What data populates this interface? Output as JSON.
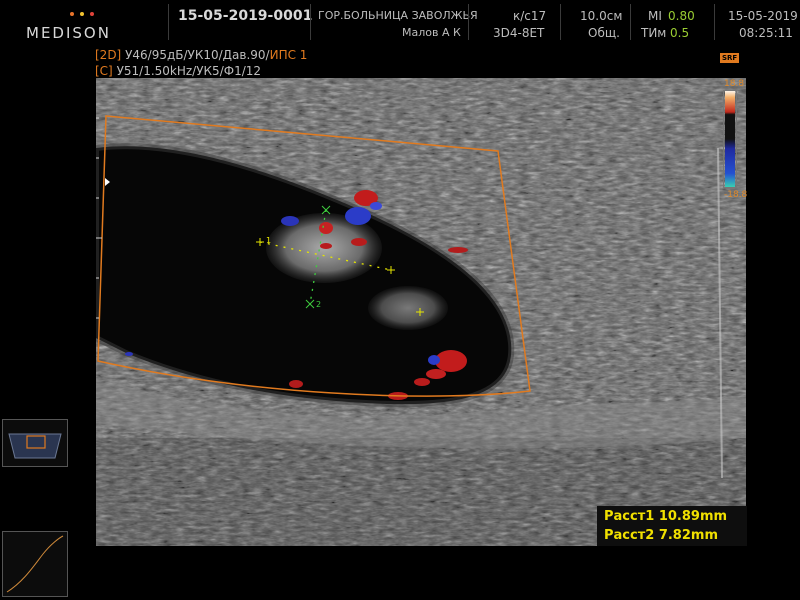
{
  "header": {
    "brand": "MEDISON",
    "brand_dot_colors": [
      "#e8732a",
      "#f2c230",
      "#e0433a"
    ],
    "patient_id": "15-05-2019-0001",
    "hospital": "ГОР.БОЛЬНИЦА ЗАВОЛЖЬЯ",
    "operator": "Малов А К",
    "frame_rate": "к/с17",
    "probe": "3D4-8ET",
    "depth": "10.0см",
    "preset": "Общ.",
    "mi_label": "MI",
    "mi_value": "0.80",
    "tim_label": "ТИм",
    "tim_value": "0.5",
    "date": "15-05-2019",
    "time": "08:25:11"
  },
  "mode_lines": {
    "line1_mode": "[2D]",
    "line1_params": " У46/95дБ/УК10/Дав.90/",
    "line1_highlight": "ИПС 1",
    "line2_mode": "[C]",
    "line2_params": " У51/1.50kHz/УК5/Ф1/12"
  },
  "color_bar": {
    "top_label": "18.8",
    "bottom_label": "-18.8",
    "badge": "SRF"
  },
  "measurements": [
    {
      "label": "Расст1",
      "value": "10.89mm"
    },
    {
      "label": "Расст2",
      "value": "7.82mm"
    }
  ],
  "caliper_labels": {
    "c1": "1",
    "c2": "2"
  },
  "accent_color": "#e07a1f"
}
